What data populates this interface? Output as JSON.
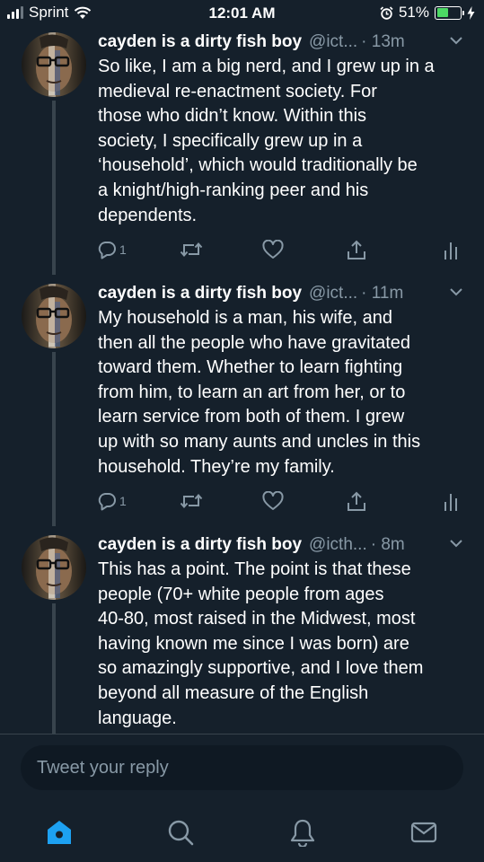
{
  "status_bar": {
    "carrier": "Sprint",
    "time": "12:01 AM",
    "battery": "51%",
    "battery_level": 0.51,
    "icons": [
      "signal-icon",
      "wifi-icon",
      "alarm-icon",
      "battery-icon",
      "charging-icon"
    ]
  },
  "tweets": [
    {
      "name": "cayden is a dirty fish boy",
      "handle": "@ict...",
      "time": "· 13m",
      "text": "So like, I am a big nerd, and I grew up in a\nmedieval re-enactment society. For\nthose who didn’t know. Within this\nsociety, I specifically grew up in a\n‘household’, which would traditionally be\na knight/high-ranking peer and his\ndependents.",
      "reply_count": "1"
    },
    {
      "name": "cayden is a dirty fish boy",
      "handle": "@ict...",
      "time": "· 11m",
      "text": "My household is a man, his wife, and\nthen all the people who have gravitated\ntoward them. Whether to learn fighting\nfrom him, to learn an art from her, or to\nlearn service from both of them. I grew\nup with so many aunts and uncles in this\nhousehold. They’re my family.",
      "reply_count": "1"
    },
    {
      "name": "cayden is a dirty fish boy",
      "handle": "@icth...",
      "time": "· 8m",
      "text": "This has a point. The point is that these\npeople (70+ white people from ages\n40-80, most raised in the Midwest, most\nhaving known me since I was born) are\nso amazingly supportive, and I love them\nbeyond all measure of the English\nlanguage.",
      "reply_count": ""
    }
  ],
  "reply": {
    "placeholder": "Tweet your reply"
  },
  "tab_bar": {
    "active": "home",
    "accent_color": "#1da1f2",
    "icons": [
      "home-icon",
      "search-icon",
      "notifications-icon",
      "messages-icon"
    ]
  },
  "colors": {
    "background": "#15202b",
    "secondary_text": "#8899a6",
    "divider": "#38444d",
    "accent": "#1da1f2"
  }
}
